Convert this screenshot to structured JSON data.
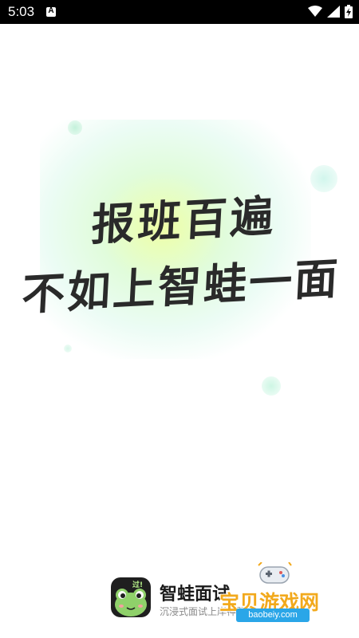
{
  "status_bar": {
    "time": "5:03",
    "notification_letter": "A",
    "icons": [
      "notification-a-icon",
      "wifi-icon",
      "signal-icon",
      "battery-charging-icon"
    ]
  },
  "splash": {
    "line1": "报班百遍",
    "line2": "不如上智蛙一面",
    "accent_color": "#d9f7a8"
  },
  "brand": {
    "app_name": "智蛙面试",
    "tagline": "沉浸式面试上岸神器",
    "logo_icon": "frog-logo-icon",
    "logo_badge": "过!"
  },
  "watermark": {
    "text": "宝贝游戏网",
    "url": "baobeiy.com",
    "icon": "gamepad-icon",
    "color": "#f2a91c"
  }
}
